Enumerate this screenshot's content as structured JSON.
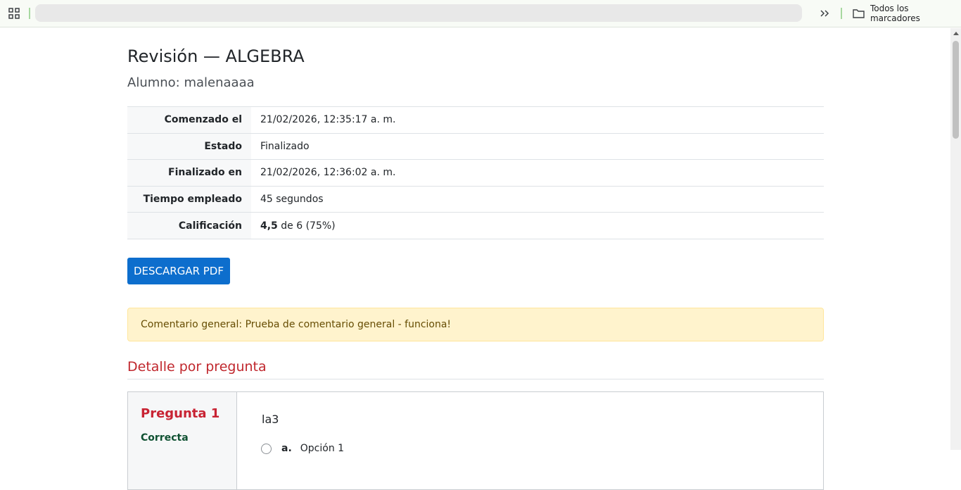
{
  "bookmarks_bar": {
    "all_bookmarks_label": "Todos los marcadores"
  },
  "page": {
    "title": "Revisión — ALGEBRA",
    "student_line": "Alumno: malenaaaa"
  },
  "attempt_info": {
    "rows": [
      {
        "label": "Comenzado el",
        "value": "21/02/2026, 12:35:17 a. m."
      },
      {
        "label": "Estado",
        "value": "Finalizado"
      },
      {
        "label": "Finalizado en",
        "value": "21/02/2026, 12:36:02 a. m."
      },
      {
        "label": "Tiempo empleado",
        "value": "45 segundos"
      }
    ],
    "grade": {
      "label": "Calificación",
      "score": "4,5",
      "rest": " de 6 (75%)"
    }
  },
  "actions": {
    "download_pdf_label": "DESCARGAR PDF"
  },
  "general_comment": "Comentario general: Prueba de comentario general - funciona!",
  "questions_section": {
    "title": "Detalle por pregunta",
    "questions": [
      {
        "number_label": "Pregunta 1",
        "status": "Correcta",
        "text": "la3",
        "options": [
          {
            "letter": "a.",
            "label": "Opción 1"
          }
        ]
      }
    ]
  },
  "colors": {
    "primary": "#0d6ecd",
    "accent_red": "#c0272d",
    "success_text": "#0f5132",
    "warning_bg": "#fff3cd"
  }
}
